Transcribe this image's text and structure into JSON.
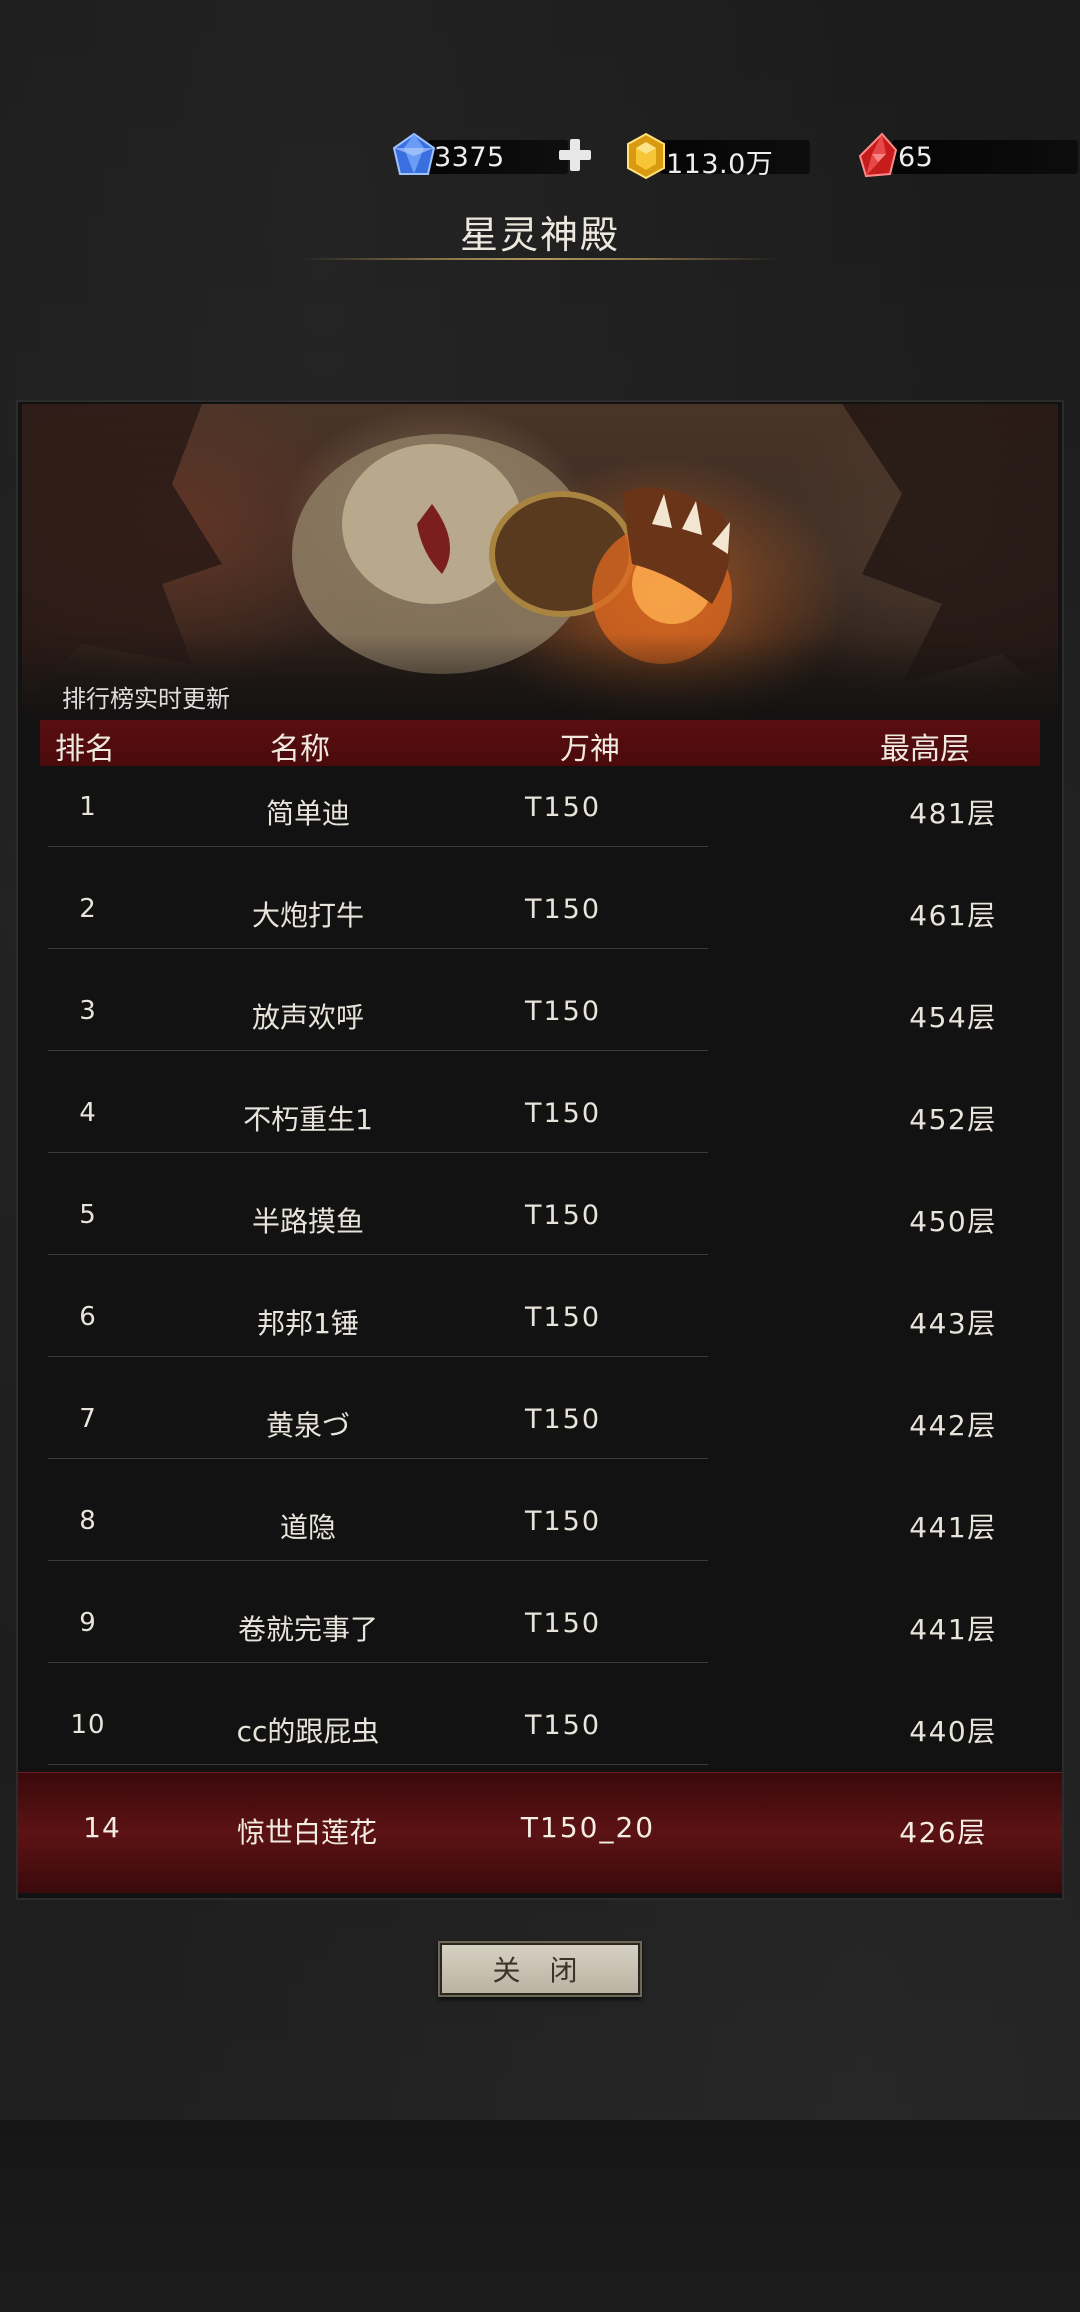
{
  "currency": {
    "diamond": "3375",
    "gold": "113.0万",
    "ruby": "65"
  },
  "title": "星灵神殿",
  "realtime_text": "排行榜实时更新",
  "columns": {
    "rank": "排名",
    "name": "名称",
    "god": "万神",
    "floor": "最高层"
  },
  "rows": [
    {
      "rank": "1",
      "name": "简单迪",
      "god": "T150",
      "floor": "481层"
    },
    {
      "rank": "2",
      "name": "大炮打牛",
      "god": "T150",
      "floor": "461层"
    },
    {
      "rank": "3",
      "name": "放声欢呼",
      "god": "T150",
      "floor": "454层"
    },
    {
      "rank": "4",
      "name": "不朽重生1",
      "god": "T150",
      "floor": "452层"
    },
    {
      "rank": "5",
      "name": "半路摸鱼",
      "god": "T150",
      "floor": "450层"
    },
    {
      "rank": "6",
      "name": "邦邦1锤",
      "god": "T150",
      "floor": "443层"
    },
    {
      "rank": "7",
      "name": "黄泉づ",
      "god": "T150",
      "floor": "442层"
    },
    {
      "rank": "8",
      "name": "道隐",
      "god": "T150",
      "floor": "441层"
    },
    {
      "rank": "9",
      "name": "卷就完事了",
      "god": "T150",
      "floor": "441层"
    },
    {
      "rank": "10",
      "name": "cc的跟屁虫",
      "god": "T150",
      "floor": "440层"
    }
  ],
  "my_rank": {
    "rank": "14",
    "name": "惊世白莲花",
    "god": "T150_20",
    "floor": "426层"
  },
  "close_label": "关 闭",
  "colors": {
    "header_red": "#5a0e10",
    "my_row_red": "#5c1214",
    "gold_line": "#b39a62"
  },
  "icons": [
    "diamond-icon",
    "plus-icon",
    "gold-gem-icon",
    "ruby-icon"
  ]
}
